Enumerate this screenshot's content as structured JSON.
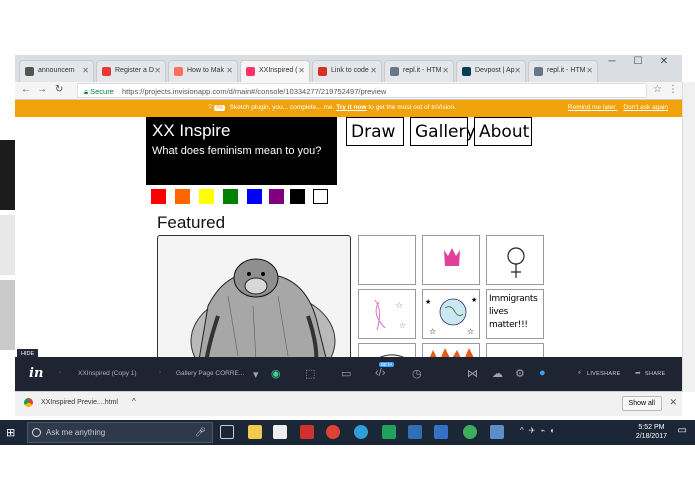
{
  "browser": {
    "tabs": [
      {
        "label": "announcem",
        "color": "#555555"
      },
      {
        "label": "Register a D",
        "color": "#e53935"
      },
      {
        "label": "How to Mak",
        "color": "#ff6f61"
      },
      {
        "label": "XXInspired (",
        "color": "#ff3366"
      },
      {
        "label": "Link to code",
        "color": "#d93025"
      },
      {
        "label": "repl.it - HTM",
        "color": "#667788"
      },
      {
        "label": "Devpost | Ap",
        "color": "#003e54"
      },
      {
        "label": "repl.it - HTM",
        "color": "#667788"
      }
    ],
    "secure_label": "Secure",
    "url": "https://projects.invisionapp.com/d/main#/console/10334277/219752497/preview"
  },
  "banner": {
    "badge": "Ps",
    "message": "Sketch plugin, you... complete... me.",
    "link": "Try it now",
    "message_tail": "to get the most out of InVision.",
    "remind": "Remind me later",
    "dismiss": "Don't ask again"
  },
  "prototype": {
    "title": "XX Inspire",
    "subtitle": "What does feminism mean to you?",
    "nav": [
      "Draw",
      "Gallery",
      "About"
    ],
    "swatches": [
      "#ff0000",
      "#ff6600",
      "#ffff00",
      "#008000",
      "#0000ff",
      "#800080",
      "#000000",
      "#ffffff"
    ],
    "featured": "Featured",
    "grid_text": "Immigrants lives matter!!!"
  },
  "toolbar": {
    "hide": "HIDE",
    "logo": "in",
    "project": "XXInspired (Copy 1)",
    "page": "Gallery Page CORRE...",
    "beta": "BETA",
    "liveshare": "LIVESHARE",
    "share": "SHARE"
  },
  "downloads": {
    "file": "XXInspired Previe....html",
    "show_all": "Show all"
  },
  "taskbar": {
    "search": "Ask me anything",
    "time": "5:52 PM",
    "date": "2/18/2017"
  }
}
